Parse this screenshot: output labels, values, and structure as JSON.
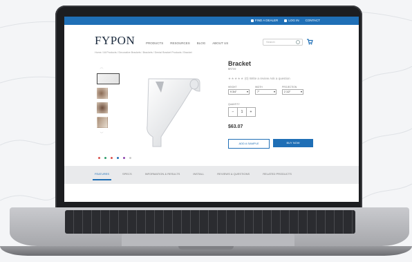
{
  "topbar": {
    "links": [
      "FIND A DEALER",
      "LOG IN",
      "CONTACT"
    ],
    "color": "#1f6fb6"
  },
  "header": {
    "logo": "FYPON",
    "nav": [
      "PRODUCTS",
      "RESOURCES",
      "BLOG",
      "ABOUT US"
    ],
    "search_placeholder": "Search"
  },
  "breadcrumb": "Home / All Products / Decorative Brackets / Brackets / Dental Bracket Products / Bracket",
  "product": {
    "title": "Bracket",
    "sku": "BR7X9",
    "stars": "★★★★★",
    "review_count": "(0)",
    "rating_text": "Write a review   Ask a question",
    "options": [
      {
        "label": "HEIGHT",
        "value": "9 3/4\""
      },
      {
        "label": "WIDTH",
        "value": "7\""
      },
      {
        "label": "PROJECTION",
        "value": "2 1/2\""
      }
    ],
    "qty_label": "QUANTITY",
    "qty": {
      "minus": "−",
      "value": "1",
      "plus": "+"
    },
    "price": "$63.07",
    "add_button": "ADD A SAMPLE",
    "buy_button": "BUY NOW"
  },
  "gallery": {
    "up_arrow": "︿",
    "down_arrow": "﹀",
    "color_dots": [
      "#d9534f",
      "#2e9e6b",
      "#d9534f",
      "#1f6fb6",
      "#8e44ad",
      "#cccccc"
    ]
  },
  "tabs": [
    "FEATURES",
    "SPECS",
    "INFORMATION & RESULTS",
    "INSTALL",
    "REVIEWS & QUESTIONS",
    "RELATED PRODUCTS"
  ]
}
